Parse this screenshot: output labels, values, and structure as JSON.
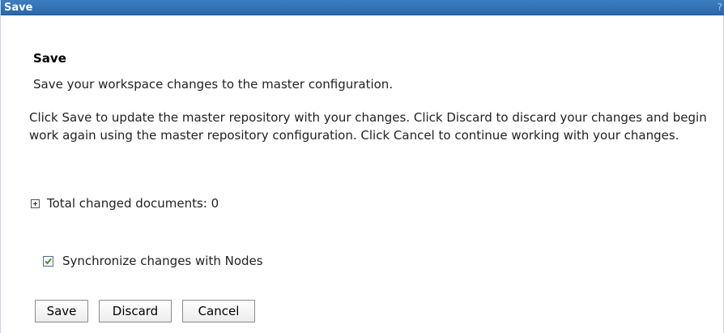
{
  "window": {
    "title": "Save",
    "help_label": "?"
  },
  "content": {
    "heading": "Save",
    "subtitle": "Save your workspace changes to the master configuration.",
    "instructions": "Click Save to update the master repository with your changes. Click Discard to discard your changes and begin work again using the master repository configuration. Click Cancel to continue working with your changes.",
    "changed_documents": "Total changed documents: 0",
    "expander_icon": "plus-box-icon",
    "sync": {
      "label": "Synchronize changes with Nodes",
      "checked": true
    }
  },
  "buttons": {
    "save_label": "Save",
    "discard_label": "Discard",
    "cancel_label": "Cancel"
  },
  "colors": {
    "titlebar": "#2b68a8",
    "title_text": "#ffffff",
    "checkmark": "#3a8a2a"
  }
}
